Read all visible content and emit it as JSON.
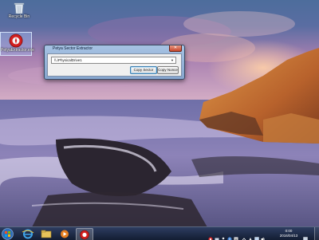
{
  "desktop": {
    "icons": [
      {
        "label": "Recycle Bin",
        "icon": "recycle-bin-icon"
      },
      {
        "label": "PetyaExtractor.exe",
        "icon": "petya-app-icon"
      }
    ]
  },
  "window": {
    "title": "Petya Sector Extractor",
    "drive_select": {
      "value": "\\\\.\\PhysicalDrive1"
    },
    "buttons": {
      "copy_sector": "Copy Sector",
      "copy_nonce": "Copy Nonce"
    }
  },
  "taskbar": {
    "pinned": [
      "internet-explorer-icon",
      "windows-explorer-icon",
      "media-player-icon",
      "petya-app-icon"
    ],
    "clock": {
      "time": "0:00",
      "date": "2016/04/13"
    }
  },
  "colors": {
    "taskbar": "#1c2b47",
    "window_frame": "#9bb8dc",
    "close_button": "#c8472c"
  }
}
